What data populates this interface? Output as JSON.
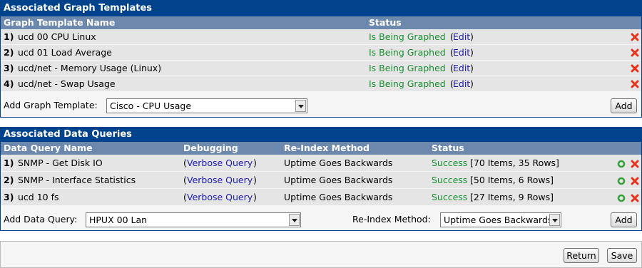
{
  "graph_templates": {
    "title": "Associated Graph Templates",
    "headers": {
      "name": "Graph Template Name",
      "status": "Status"
    },
    "rows": [
      {
        "num": "1)",
        "name": "ucd 00 CPU Linux",
        "status": "Is Being Graphed",
        "edit_open": "(",
        "edit": "Edit",
        "edit_close": ")"
      },
      {
        "num": "2)",
        "name": "ucd 01 Load Average",
        "status": "Is Being Graphed",
        "edit_open": "(",
        "edit": "Edit",
        "edit_close": ")"
      },
      {
        "num": "3)",
        "name": "ucd/net - Memory Usage (Linux)",
        "status": "Is Being Graphed",
        "edit_open": "(",
        "edit": "Edit",
        "edit_close": ")"
      },
      {
        "num": "4)",
        "name": "ucd/net - Swap Usage",
        "status": "Is Being Graphed",
        "edit_open": "(",
        "edit": "Edit",
        "edit_close": ")"
      }
    ],
    "add_label": "Add Graph Template:",
    "add_selected": "Cisco - CPU Usage",
    "add_button": "Add",
    "delete_icon": "red-x-delete-icon"
  },
  "data_queries": {
    "title": "Associated Data Queries",
    "headers": {
      "name": "Data Query Name",
      "debugging": "Debugging",
      "reindex": "Re-Index Method",
      "status": "Status"
    },
    "rows": [
      {
        "num": "1)",
        "name": "SNMP - Get Disk IO",
        "debug_open": "(",
        "debug": "Verbose Query",
        "debug_close": ")",
        "reindex": "Uptime Goes Backwards",
        "status": "Success",
        "detail": "[70 Items, 35 Rows]"
      },
      {
        "num": "2)",
        "name": "SNMP - Interface Statistics",
        "debug_open": "(",
        "debug": "Verbose Query",
        "debug_close": ")",
        "reindex": "Uptime Goes Backwards",
        "status": "Success",
        "detail": "[50 Items, 6 Rows]"
      },
      {
        "num": "3)",
        "name": "ucd 10 fs",
        "debug_open": "(",
        "debug": "Verbose Query",
        "debug_close": ")",
        "reindex": "Uptime Goes Backwards",
        "status": "Success",
        "detail": "[27 Items, 9 Rows]"
      }
    ],
    "add_label": "Add Data Query:",
    "add_selected": "HPUX 00 Lan",
    "reindex_label": "Re-Index Method:",
    "reindex_selected": "Uptime Goes Backwards",
    "add_button": "Add",
    "reload_icon": "green-circle-reload-icon",
    "delete_icon": "red-x-delete-icon"
  },
  "footer": {
    "return_button": "Return",
    "save_button": "Save"
  },
  "colors": {
    "title_bar": "#00438c",
    "header_bar": "#6d88ad",
    "row_bg": "#e5e5e5",
    "success": "#198e32",
    "link": "#1b1bb3",
    "delete": "#e8321a"
  }
}
